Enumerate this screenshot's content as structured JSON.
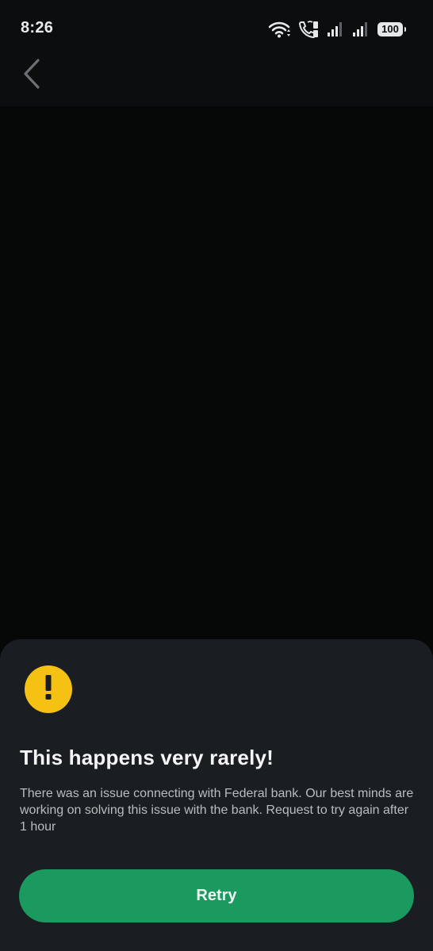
{
  "status_bar": {
    "time": "8:26",
    "battery": "100",
    "icons": [
      "wifi-icon",
      "wifi-calling-icon",
      "signal-1-icon",
      "signal-2-icon",
      "battery-icon"
    ]
  },
  "nav": {
    "back_icon": "chevron-left-icon"
  },
  "error_sheet": {
    "icon": "exclamation-icon",
    "accent_color": "#f5c113",
    "title": "This happens very rarely!",
    "message": "There was an issue connecting with Federal bank. Our best minds are working on solving this issue with the bank. Request to try again after 1 hour",
    "retry_label": "Retry",
    "button_color": "#1b9a5f"
  }
}
